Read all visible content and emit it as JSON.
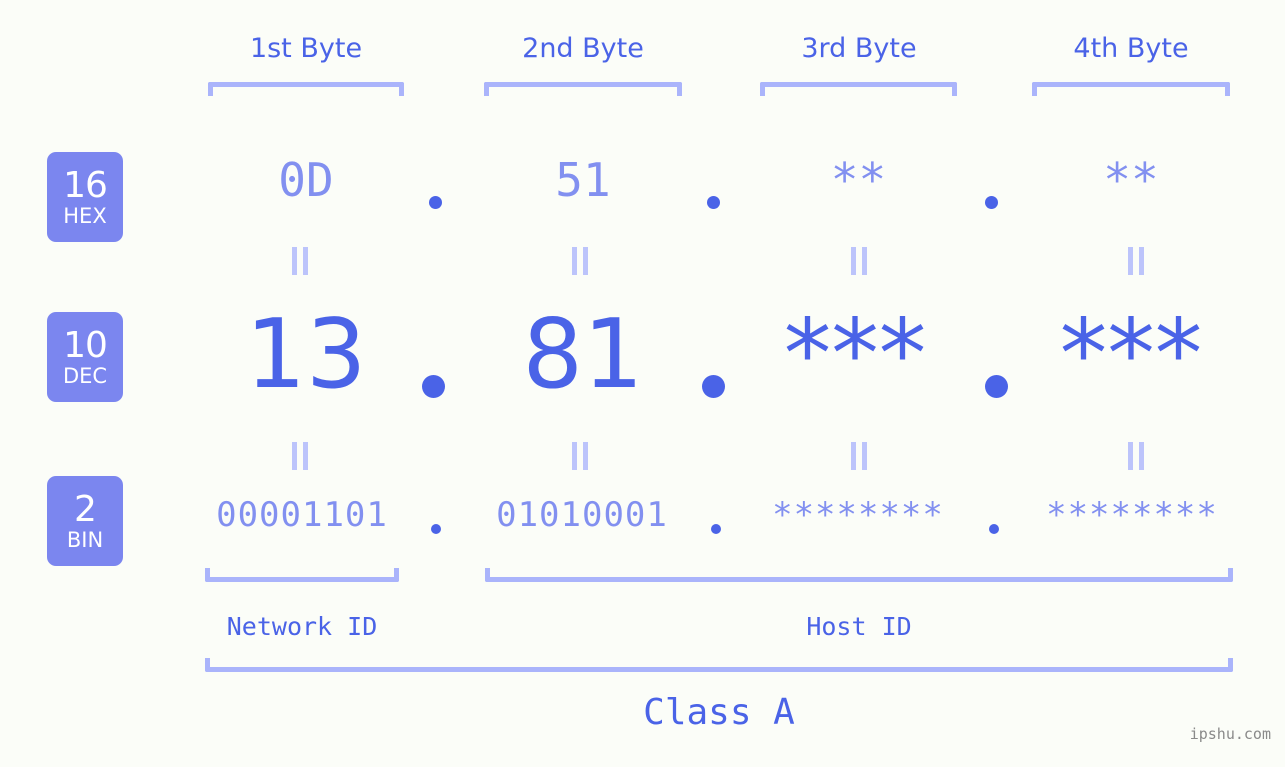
{
  "meta": {
    "background_color": "#fbfdf8",
    "accent_strong": "#4a63e7",
    "accent_mid": "#7b86ef",
    "accent_light": "#8290f0",
    "accent_pale": "#aab4fb",
    "badge_text_color": "#ffffff",
    "watermark": "ipshu.com"
  },
  "byte_headers": [
    {
      "label": "1st Byte"
    },
    {
      "label": "2nd Byte"
    },
    {
      "label": "3rd Byte"
    },
    {
      "label": "4th Byte"
    }
  ],
  "rows": [
    {
      "key": "hex",
      "badge_number": "16",
      "badge_unit": "HEX",
      "values": [
        "0D",
        "51",
        "**",
        "**"
      ],
      "separator": "."
    },
    {
      "key": "dec",
      "badge_number": "10",
      "badge_unit": "DEC",
      "values": [
        "13",
        "81",
        "***",
        "***"
      ],
      "separator": "."
    },
    {
      "key": "bin",
      "badge_number": "2",
      "badge_unit": "BIN",
      "values": [
        "00001101",
        "01010001",
        "********",
        "********"
      ],
      "separator": "."
    }
  ],
  "equals_connector": "=",
  "id_sections": [
    {
      "label": "Network ID"
    },
    {
      "label": "Host ID"
    }
  ],
  "class_section": {
    "label": "Class A"
  }
}
